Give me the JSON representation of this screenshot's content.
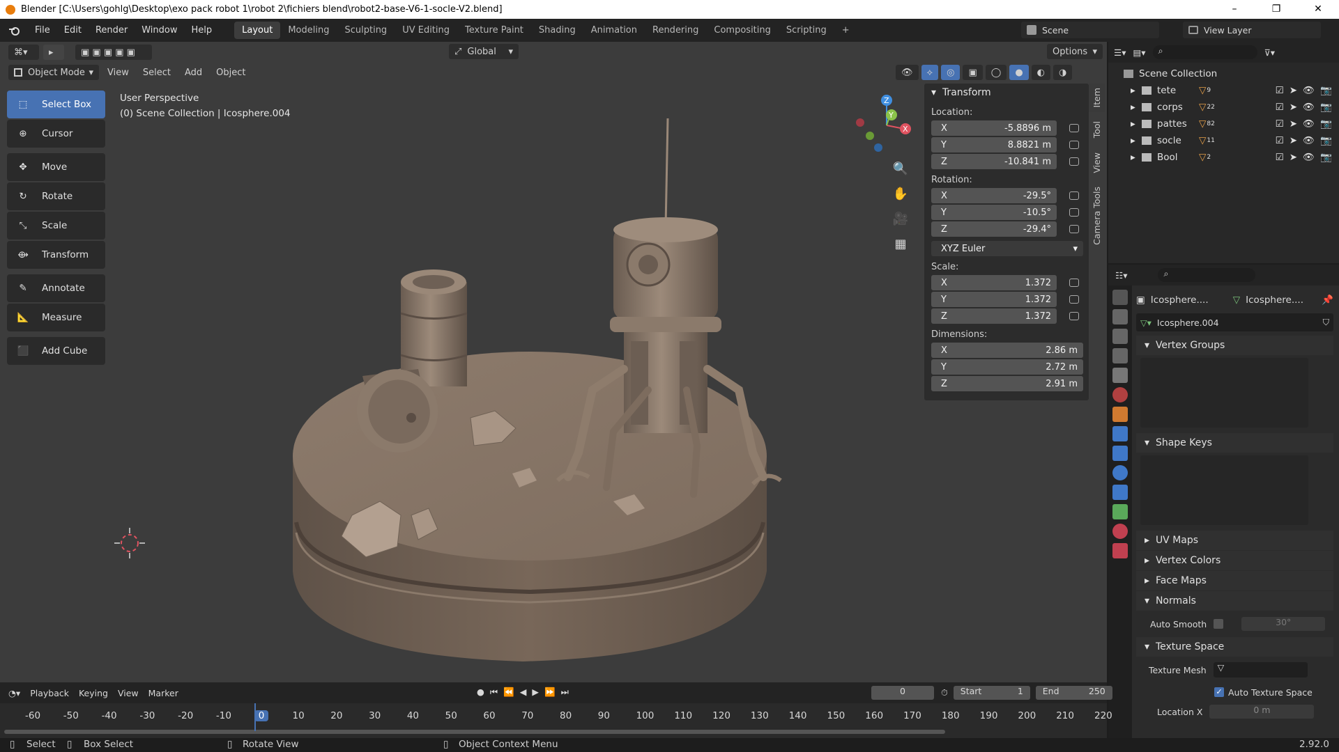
{
  "window": {
    "title": "Blender [C:\\Users\\gohlg\\Desktop\\exo pack robot 1\\robot 2\\fichiers blend\\robot2-base-V6-1-socle-V2.blend]",
    "controls": [
      "–",
      "❐",
      "✕"
    ]
  },
  "menubar": {
    "items": [
      "File",
      "Edit",
      "Render",
      "Window",
      "Help"
    ]
  },
  "workspaces": [
    "Layout",
    "Modeling",
    "Sculpting",
    "UV Editing",
    "Texture Paint",
    "Shading",
    "Animation",
    "Rendering",
    "Compositing",
    "Scripting"
  ],
  "active_workspace": "Layout",
  "scene": {
    "label": "Scene"
  },
  "view_layer": {
    "label": "View Layer"
  },
  "viewport_header": {
    "mode": "Object Mode",
    "menus": [
      "View",
      "Select",
      "Add",
      "Object"
    ],
    "transform_orientation": "Global",
    "options": "Options"
  },
  "toolbar": {
    "tools": [
      "Select Box",
      "Cursor",
      "Move",
      "Rotate",
      "Scale",
      "Transform",
      "Annotate",
      "Measure",
      "Add Cube"
    ],
    "active": "Select Box"
  },
  "viewport_info": {
    "line1": "User Perspective",
    "line2": "(0) Scene Collection | Icosphere.004"
  },
  "transform_panel": {
    "title": "Transform",
    "location_label": "Location:",
    "location": {
      "x": "-5.8896 m",
      "y": "8.8821 m",
      "z": "-10.841 m"
    },
    "rotation_label": "Rotation:",
    "rotation": {
      "x": "-29.5°",
      "y": "-10.5°",
      "z": "-29.4°"
    },
    "rotation_mode": "XYZ Euler",
    "scale_label": "Scale:",
    "scale": {
      "x": "1.372",
      "y": "1.372",
      "z": "1.372"
    },
    "dimensions_label": "Dimensions:",
    "dimensions": {
      "x": "2.86 m",
      "y": "2.72 m",
      "z": "2.91 m"
    },
    "axis_labels": [
      "X",
      "Y",
      "Z"
    ]
  },
  "npanel_tabs": [
    "Item",
    "Tool",
    "View",
    "Camera Tools"
  ],
  "outliner": {
    "root": "Scene Collection",
    "items": [
      {
        "name": "tete",
        "badge": "9"
      },
      {
        "name": "corps",
        "badge": "22"
      },
      {
        "name": "pattes",
        "badge": "82"
      },
      {
        "name": "socle",
        "badge": "11"
      },
      {
        "name": "Bool",
        "badge": "2"
      }
    ]
  },
  "properties": {
    "object_name": "Icosphere....",
    "mesh_name": "Icosphere....",
    "data_name": "Icosphere.004",
    "sections": [
      "Vertex Groups",
      "Shape Keys",
      "UV Maps",
      "Vertex Colors",
      "Face Maps",
      "Normals",
      "Texture Space"
    ],
    "auto_smooth_label": "Auto Smooth",
    "auto_smooth_angle": "30°",
    "texture_mesh_label": "Texture Mesh",
    "auto_texture_space_label": "Auto Texture Space",
    "location_x_label": "Location X",
    "location_x_value": "0 m"
  },
  "timeline": {
    "menus": [
      "Playback",
      "Keying",
      "View",
      "Marker"
    ],
    "current_frame": "0",
    "start_label": "Start",
    "start": "1",
    "end_label": "End",
    "end": "250",
    "ticks": [
      "-60",
      "-50",
      "-40",
      "-30",
      "-20",
      "-10",
      "0",
      "10",
      "20",
      "30",
      "40",
      "50",
      "60",
      "70",
      "80",
      "90",
      "100",
      "110",
      "120",
      "130",
      "140",
      "150",
      "160",
      "170",
      "180",
      "190",
      "200",
      "210",
      "220"
    ]
  },
  "statusbar": {
    "select": "Select",
    "box_select": "Box Select",
    "rotate_view": "Rotate View",
    "context_menu": "Object Context Menu",
    "version": "2.92.0"
  },
  "colors": {
    "accent": "#4772b3",
    "x_axis": "#e05360",
    "y_axis": "#8bc34a",
    "z_axis": "#3f8ee0",
    "model": "#8a7868"
  }
}
